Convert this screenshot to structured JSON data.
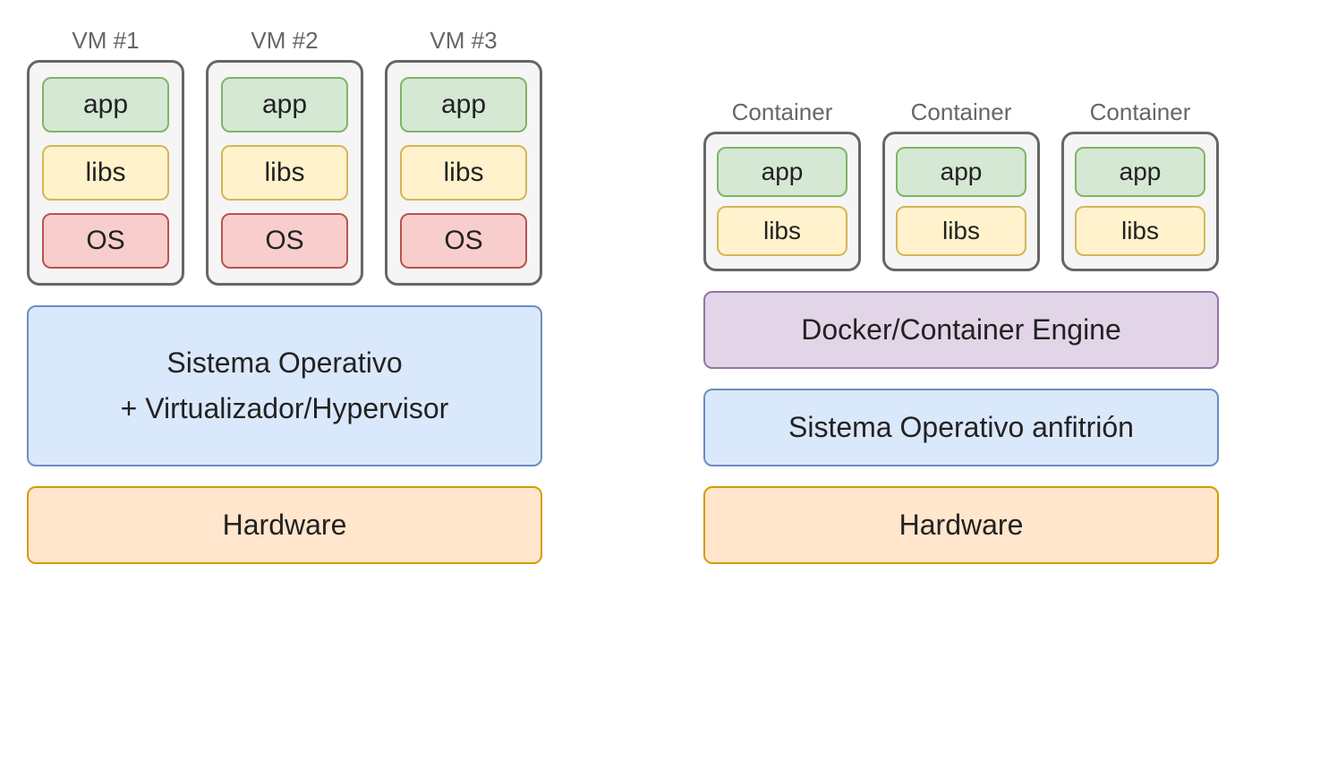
{
  "left": {
    "vms": [
      {
        "label": "VM #1",
        "app": "app",
        "libs": "libs",
        "os": "OS"
      },
      {
        "label": "VM #2",
        "app": "app",
        "libs": "libs",
        "os": "OS"
      },
      {
        "label": "VM #3",
        "app": "app",
        "libs": "libs",
        "os": "OS"
      }
    ],
    "os_layer_line1": "Sistema Operativo",
    "os_layer_line2": "+ Virtualizador/Hypervisor",
    "hardware": "Hardware"
  },
  "right": {
    "containers": [
      {
        "label": "Container",
        "app": "app",
        "libs": "libs"
      },
      {
        "label": "Container",
        "app": "app",
        "libs": "libs"
      },
      {
        "label": "Container",
        "app": "app",
        "libs": "libs"
      }
    ],
    "engine": "Docker/Container Engine",
    "host_os": "Sistema Operativo anfitrión",
    "hardware": "Hardware"
  }
}
